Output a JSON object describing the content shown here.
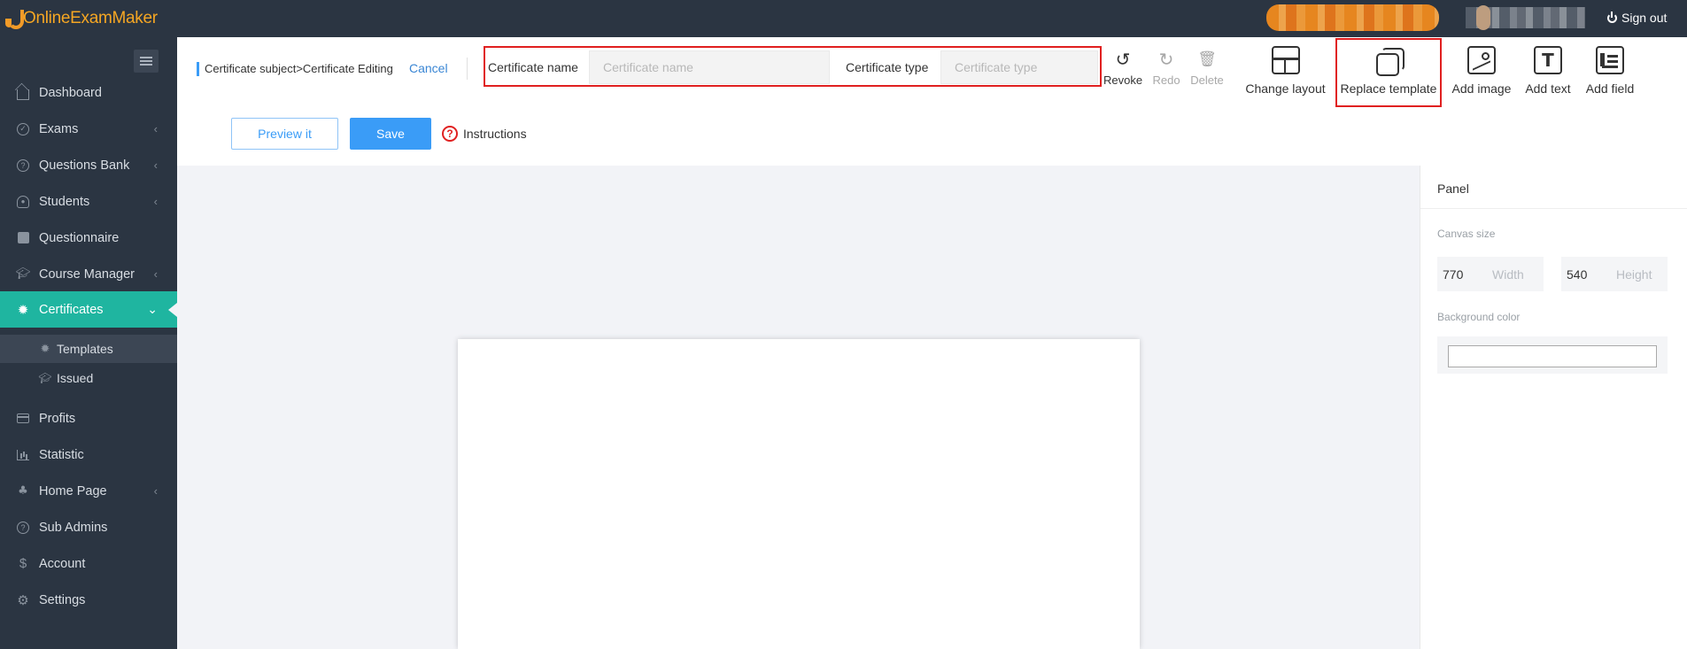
{
  "app": {
    "logo_text": "OnlineExamMaker",
    "signout_label": "Sign out"
  },
  "sidebar": {
    "items": [
      {
        "label": "Dashboard",
        "icon": "home-icon",
        "chevron": ""
      },
      {
        "label": "Exams",
        "icon": "check-circle-icon",
        "chevron": "‹"
      },
      {
        "label": "Questions Bank",
        "icon": "question-circle-icon",
        "chevron": "‹"
      },
      {
        "label": "Students",
        "icon": "user-icon",
        "chevron": "‹"
      },
      {
        "label": "Questionnaire",
        "icon": "checkbox-icon",
        "chevron": ""
      },
      {
        "label": "Course Manager",
        "icon": "graduation-cap-icon",
        "chevron": "‹"
      },
      {
        "label": "Certificates",
        "icon": "badge-icon",
        "chevron": "⌄"
      },
      {
        "label": "Profits",
        "icon": "card-icon",
        "chevron": ""
      },
      {
        "label": "Statistic",
        "icon": "bar-chart-icon",
        "chevron": ""
      },
      {
        "label": "Home Page",
        "icon": "tree-icon",
        "chevron": "‹"
      },
      {
        "label": "Sub Admins",
        "icon": "question-circle-icon",
        "chevron": ""
      },
      {
        "label": "Account",
        "icon": "dollar-icon",
        "chevron": ""
      },
      {
        "label": "Settings",
        "icon": "gear-icon",
        "chevron": ""
      }
    ],
    "subitems": [
      {
        "label": "Templates",
        "icon": "badge-icon"
      },
      {
        "label": "Issued",
        "icon": "graduation-cap-icon"
      }
    ]
  },
  "header": {
    "breadcrumb": "Certificate subject>Certificate Editing",
    "cancel_label": "Cancel",
    "certificate_name_label": "Certificate name",
    "certificate_name_placeholder": "Certificate name",
    "certificate_name_value": "",
    "certificate_type_label": "Certificate type",
    "certificate_type_placeholder": "Certificate type",
    "certificate_type_value": ""
  },
  "toolbar": {
    "revoke": "Revoke",
    "redo": "Redo",
    "delete": "Delete",
    "change_layout": "Change layout",
    "replace_template": "Replace template",
    "add_image": "Add image",
    "add_text": "Add text",
    "add_field": "Add field"
  },
  "actions": {
    "preview_label": "Preview it",
    "save_label": "Save",
    "instructions_label": "Instructions"
  },
  "panel": {
    "title": "Panel",
    "canvas_size_label": "Canvas size",
    "width_value": "770",
    "width_unit": "Width",
    "height_value": "540",
    "height_unit": "Height",
    "background_color_label": "Background color",
    "background_color_value": ""
  },
  "colors": {
    "sidebar_bg": "#2b3542",
    "active_teal": "#1fb5a0",
    "primary_blue": "#3a9cf7",
    "highlight_red": "#e02020",
    "logo_orange": "#f29b28"
  }
}
